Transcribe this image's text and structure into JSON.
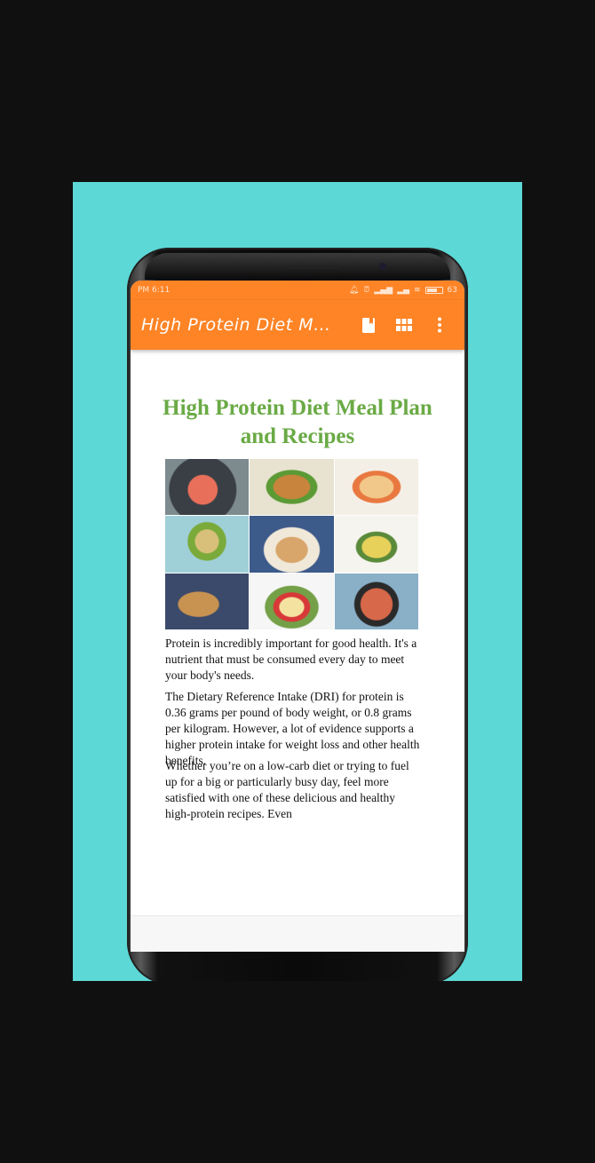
{
  "status_bar": {
    "time": "PM 6:11",
    "battery": "63"
  },
  "app_bar": {
    "title": "High Protein Diet Mea…",
    "icons": [
      "bookmark-icon",
      "grid-icon",
      "more-vert-icon"
    ]
  },
  "document": {
    "title": "High Protein Diet Meal Plan and Recipes",
    "paragraphs": [
      "Protein is incredibly important for good health. It's a nutrient that must be consumed every day to meet your body's needs.",
      "The Dietary Reference Intake (DRI) for protein is 0.36 grams per pound of body weight, or 0.8 grams per kilogram. However, a lot of evidence supports a higher protein intake for weight loss and other health benefits.",
      "Whether you’re on a low-carb diet or trying to fuel up for a big or particularly busy day, feel more satisfied with one of these delicious and healthy high-protein recipes. Even"
    ]
  },
  "colors": {
    "background": "#101010",
    "frame": "#5cd8d6",
    "app_bar": "#fe8426",
    "title_green": "#6aaa45"
  }
}
